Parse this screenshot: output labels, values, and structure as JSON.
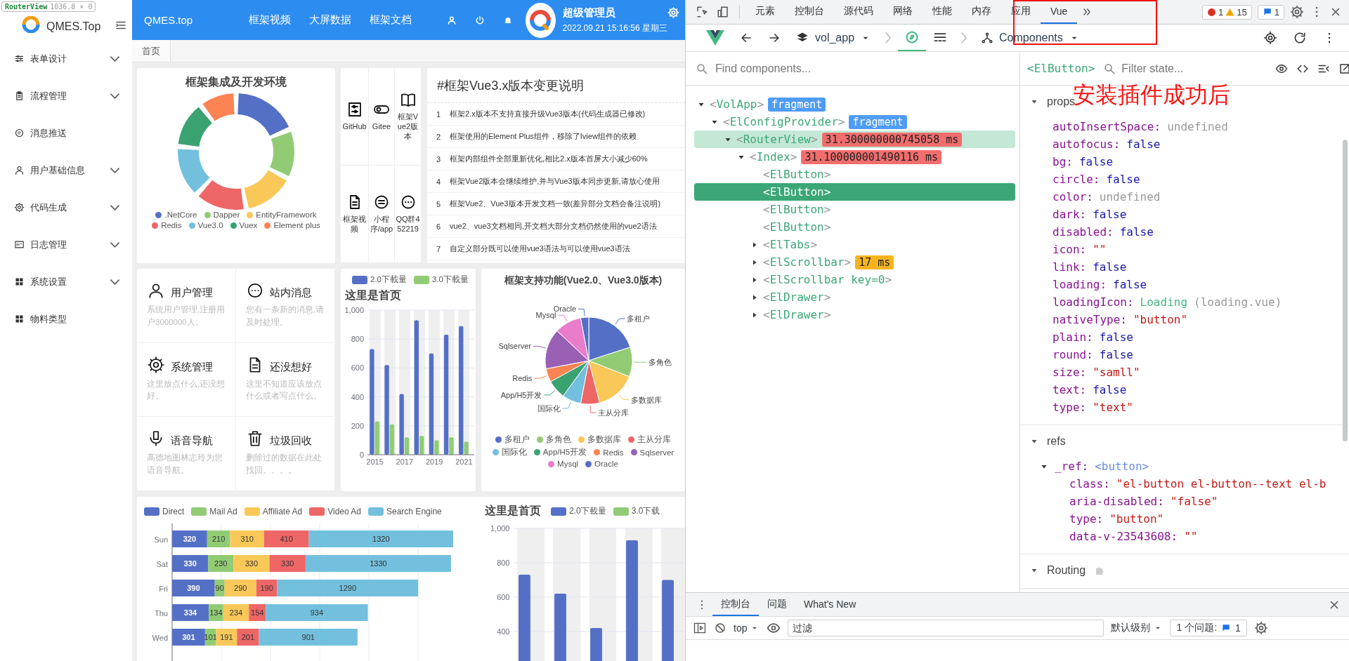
{
  "inspector_tooltip": {
    "component": "RouterView",
    "size": "1036.8 × 0"
  },
  "app": {
    "logo_text": "QMES.Top",
    "header": {
      "site": "QMES.top",
      "nav": [
        "框架视频",
        "大屏数据",
        "框架文档"
      ],
      "user_name": "超级管理员",
      "datetime": "2022.09.21 15:16:56 星期三"
    },
    "sidebar": {
      "items": [
        {
          "label": "表单设计",
          "expandable": true
        },
        {
          "label": "流程管理",
          "expandable": true
        },
        {
          "label": "消息推送",
          "expandable": false
        },
        {
          "label": "用户基础信息",
          "expandable": true
        },
        {
          "label": "代码生成",
          "expandable": true
        },
        {
          "label": "日志管理",
          "expandable": true
        },
        {
          "label": "系统设置",
          "expandable": true
        },
        {
          "label": "物料类型",
          "expandable": false
        }
      ]
    },
    "tabs": [
      {
        "label": "首页",
        "selected": true
      }
    ],
    "framework_card": {
      "title": "框架集成及开发环境",
      "legend": [
        {
          "label": ".NetCore",
          "color": "#5470c6"
        },
        {
          "label": "Dapper",
          "color": "#91cc75"
        },
        {
          "label": "EntityFramework",
          "color": "#fac858"
        },
        {
          "label": "Redis",
          "color": "#ee6666"
        },
        {
          "label": "Vue3.0",
          "color": "#73c0de"
        },
        {
          "label": "Vuex",
          "color": "#3ba272"
        },
        {
          "label": "Element plus",
          "color": "#fc8452"
        }
      ]
    },
    "links": [
      {
        "label": "GitHub"
      },
      {
        "label": "Gitee"
      },
      {
        "label": "框架Vue2版本"
      },
      {
        "label": "框架视频"
      },
      {
        "label": "小程序/app"
      },
      {
        "label": "QQ群452219"
      }
    ],
    "changelog": {
      "title": "#框架Vue3.x版本变更说明",
      "rows": [
        {
          "no": "1",
          "text": "框架2.x版本不支持直接升级Vue3版本(代码生成器已修改)"
        },
        {
          "no": "2",
          "text": "框架使用的Element Plus组件，移除了Iview组件的依赖"
        },
        {
          "no": "3",
          "text": "框架内部组件全部重新优化,相比2.x版本首屏大小减少60%"
        },
        {
          "no": "4",
          "text": "框架Vue2版本会继续维护,并与Vue3版本同步更新,请放心使用"
        },
        {
          "no": "5",
          "text": "框架Vue2、Vue3版本开发文档一致(差异部分文档会备注说明)"
        },
        {
          "no": "6",
          "text": "vue2、vue3文档相同,开文档大部分文档仍然使用的vue2语法"
        },
        {
          "no": "7",
          "text": "自定义部分既可以使用vue3语法与可以使用vue3语法"
        }
      ]
    },
    "features": [
      {
        "title": "用户管理",
        "desc": "系统用户管理,注册用户3000000人。"
      },
      {
        "title": "站内消息",
        "desc": "您有一条新的消息,请及时处理。"
      },
      {
        "title": "系统管理",
        "desc": "这里放点什么,还没想好。"
      },
      {
        "title": "还没想好",
        "desc": "这里不知道应该放点什么或者写点什么。"
      },
      {
        "title": "语音导航",
        "desc": "高德地图林志玲为您语音导航。"
      },
      {
        "title": "垃圾回收",
        "desc": "删除过的数据在此处找回。。。。"
      }
    ],
    "download_chart": {
      "chart_data": {
        "type": "bar",
        "title": "这里是首页",
        "x": [
          2015,
          2016,
          2017,
          2018,
          2019,
          2020,
          2021
        ],
        "xlim": [
          2014.5,
          2021.5
        ],
        "xticks": [
          2015,
          2017,
          2019,
          2021
        ],
        "ylim": [
          0,
          1000
        ],
        "yticks": [
          0,
          200,
          400,
          600,
          800,
          {
            "value": 1000,
            "label": "1,000"
          }
        ],
        "grid": true,
        "series": [
          {
            "name": "2.0下載量",
            "color": "#5470c6",
            "values": [
              730,
              620,
              420,
              930,
              700,
              830,
              890
            ]
          },
          {
            "name": "3.0下載量",
            "color": "#91cc75",
            "values": [
              230,
              210,
              120,
              130,
              100,
              120,
              90
            ]
          }
        ]
      }
    },
    "feature_pie": {
      "title": "框架支持功能(Vue2.0、Vue3.0版本)",
      "callouts": [
        {
          "label": "Oracle",
          "color": "#5470c6"
        },
        {
          "label": "Mysql",
          "color": "#ea7ccc"
        },
        {
          "label": "多租户",
          "color": "#5470c6"
        },
        {
          "label": "Sqlserver",
          "color": "#9a60b4"
        },
        {
          "label": "多角色",
          "color": "#91cc75"
        },
        {
          "label": "Redis",
          "color": "#fc8452"
        },
        {
          "label": "App/H5开发",
          "color": "#3ba272"
        },
        {
          "label": "多数据库",
          "color": "#fac858"
        },
        {
          "label": "国际化",
          "color": "#73c0de"
        },
        {
          "label": "主从分库",
          "color": "#ee6666"
        }
      ],
      "legend": [
        {
          "label": "多租户",
          "color": "#5470c6"
        },
        {
          "label": "多角色",
          "color": "#91cc75"
        },
        {
          "label": "多数据库",
          "color": "#fac858"
        },
        {
          "label": "主从分库",
          "color": "#ee6666"
        },
        {
          "label": "国际化",
          "color": "#73c0de"
        },
        {
          "label": "App/H5开发",
          "color": "#3ba272"
        },
        {
          "label": "Redis",
          "color": "#fc8452"
        },
        {
          "label": "Sqlserver",
          "color": "#9a60b4"
        },
        {
          "label": "Mysql",
          "color": "#ea7ccc"
        },
        {
          "label": "Oracle",
          "color": "#5470c6"
        }
      ]
    },
    "traffic_chart": {
      "chart_data": {
        "type": "bar",
        "orientation": "horizontal",
        "stacked": true,
        "data_labels": true,
        "categories": [
          "Sun",
          "Sat",
          "Fri",
          "Thu",
          "Wed"
        ],
        "series": [
          {
            "name": "Direct",
            "color": "#5470c6",
            "values": [
              320,
              330,
              390,
              334,
              301
            ]
          },
          {
            "name": "Mail Ad",
            "color": "#91cc75",
            "values": [
              210,
              230,
              90,
              134,
              101
            ]
          },
          {
            "name": "Affiliate Ad",
            "color": "#fac858",
            "values": [
              310,
              330,
              290,
              234,
              191
            ]
          },
          {
            "name": "Video Ad",
            "color": "#ee6666",
            "values": [
              410,
              330,
              190,
              154,
              201
            ]
          },
          {
            "name": "Search Engine",
            "color": "#73c0de",
            "values": [
              1320,
              1330,
              1290,
              934,
              901
            ]
          }
        ]
      }
    },
    "download_chart_2": {
      "chart_data": {
        "type": "bar",
        "title": "这里是首页",
        "ylim": [
          0,
          1000
        ],
        "yticks": [
          400,
          600,
          800,
          {
            "value": 1000,
            "label": "1,000"
          }
        ],
        "grid": true,
        "series": [
          {
            "name": "2.0下載量",
            "color": "#5470c6",
            "values": [
              730,
              620,
              420,
              930,
              700
            ]
          },
          {
            "name": "3.0下载",
            "color": "#91cc75",
            "values": [
              null,
              null,
              null,
              null,
              null
            ]
          }
        ]
      }
    }
  },
  "devtools": {
    "tabs": [
      {
        "label": "元素",
        "selected": false
      },
      {
        "label": "控制台",
        "selected": false
      },
      {
        "label": "源代码",
        "selected": false
      },
      {
        "label": "网络",
        "selected": false
      },
      {
        "label": "性能",
        "selected": false
      },
      {
        "label": "内存",
        "selected": false
      },
      {
        "label": "应用",
        "selected": false
      },
      {
        "label": "Vue",
        "selected": true
      }
    ],
    "errors": "1",
    "warnings": "15",
    "messages": "1",
    "vue_bar": {
      "app": "vol_app",
      "view": "Components"
    },
    "search": {
      "placeholder": "Find components..."
    },
    "tree": [
      {
        "tag": "<VolApp>",
        "badge": {
          "text": "fragment",
          "color": "#4f9cf5"
        },
        "expanded": true,
        "hovered": false,
        "selected": false,
        "children": [
          {
            "tag": "<ElConfigProvider>",
            "badge": {
              "text": "fragment",
              "color": "#4f9cf5"
            },
            "expanded": true,
            "hovered": false,
            "selected": false,
            "children": [
              {
                "tag": "<RouterView>",
                "badge": {
                  "text": "31.300000000745058 ms",
                  "color": "#f26d6d"
                },
                "expanded": true,
                "hovered": true,
                "selected": false,
                "children": [
                  {
                    "tag": "<Index>",
                    "badge": {
                      "text": "31.100000001490116 ms",
                      "color": "#f26d6d"
                    },
                    "expanded": true,
                    "hovered": false,
                    "selected": false,
                    "children": [
                      {
                        "tag": "<ElButton>",
                        "hovered": false,
                        "selected": false
                      },
                      {
                        "tag": "<ElButton>",
                        "hovered": false,
                        "selected": true
                      },
                      {
                        "tag": "<ElButton>",
                        "hovered": false,
                        "selected": false
                      },
                      {
                        "tag": "<ElButton>",
                        "hovered": false,
                        "selected": false
                      },
                      {
                        "tag": "<ElTabs>",
                        "expanded": false,
                        "hovered": false,
                        "selected": false
                      },
                      {
                        "tag": "<ElScrollbar>",
                        "badge": {
                          "text": "17 ms",
                          "color": "#f5b41f"
                        },
                        "expanded": false,
                        "hovered": false,
                        "selected": false
                      },
                      {
                        "tag": "<ElScrollbar key=0>",
                        "expanded": false,
                        "hovered": false,
                        "selected": false
                      },
                      {
                        "tag": "<ElDrawer>",
                        "expanded": false,
                        "hovered": false,
                        "selected": false
                      },
                      {
                        "tag": "<ElDrawer>",
                        "expanded": false,
                        "hovered": false,
                        "selected": false
                      }
                    ]
                  }
                ]
              }
            ]
          }
        ]
      }
    ],
    "inspector": {
      "component": "<ElButton>",
      "filter_placeholder": "Filter state...",
      "sections": [
        {
          "title": "props",
          "expanded": true,
          "entries": [
            {
              "key": "autoInsertSpace:",
              "value": "undefined",
              "kind": "undefined"
            },
            {
              "key": "autofocus:",
              "value": "false",
              "kind": "boolean"
            },
            {
              "key": "bg:",
              "value": "false",
              "kind": "boolean"
            },
            {
              "key": "circle:",
              "value": "false",
              "kind": "boolean"
            },
            {
              "key": "color:",
              "value": "undefined",
              "kind": "undefined"
            },
            {
              "key": "dark:",
              "value": "false",
              "kind": "boolean"
            },
            {
              "key": "disabled:",
              "value": "false",
              "kind": "boolean"
            },
            {
              "key": "icon:",
              "value": "\"\"",
              "kind": "string"
            },
            {
              "key": "link:",
              "value": "false",
              "kind": "boolean"
            },
            {
              "key": "loading:",
              "value": "false",
              "kind": "boolean"
            },
            {
              "key": "loadingIcon:",
              "value": "Loading",
              "note": "(loading.vue)",
              "kind": "component"
            },
            {
              "key": "nativeType:",
              "value": "\"button\"",
              "kind": "string"
            },
            {
              "key": "plain:",
              "value": "false",
              "kind": "boolean"
            },
            {
              "key": "round:",
              "value": "false",
              "kind": "boolean"
            },
            {
              "key": "size:",
              "value": "\"samll\"",
              "kind": "string"
            },
            {
              "key": "text:",
              "value": "false",
              "kind": "boolean"
            },
            {
              "key": "type:",
              "value": "\"text\"",
              "kind": "string"
            }
          ]
        },
        {
          "title": "refs",
          "expanded": true,
          "entries": [
            {
              "key": "_ref:",
              "value": "<button>",
              "kind": "element",
              "expanded": true,
              "children": [
                {
                  "key": "class:",
                  "value": "\"el-button el-button--text el-b",
                  "kind": "string"
                },
                {
                  "key": "aria-disabled:",
                  "value": "\"false\"",
                  "kind": "string"
                },
                {
                  "key": "type:",
                  "value": "\"button\"",
                  "kind": "string"
                },
                {
                  "key": "data-v-23543608:",
                  "value": "\"\"",
                  "kind": "string"
                }
              ]
            }
          ]
        },
        {
          "title": "Routing",
          "expanded": true
        }
      ]
    },
    "annotation": {
      "text": "安装插件成功后"
    },
    "console": {
      "tabs": [
        {
          "label": "控制台",
          "selected": true
        },
        {
          "label": "问题",
          "selected": false
        },
        {
          "label": "What's New",
          "selected": false
        }
      ],
      "context": "top",
      "filter_placeholder": "过滤",
      "level": "默认级别",
      "issues_label": "1 个问题:",
      "issues_count": "1"
    }
  }
}
